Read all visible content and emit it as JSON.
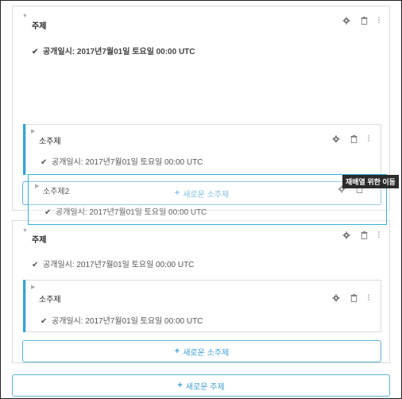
{
  "topic1": {
    "title": "주제",
    "release": "공개일시: 2017년7월01일 토요일 00:00 UTC",
    "subtopic": {
      "title": "소주제",
      "release": "공개일시: 2017년7월01일 토요일 00:00 UTC"
    },
    "add_subtopic_label": "새로운 소주제",
    "dragged_subtopic": {
      "title": "소주제2",
      "release": "공개일시: 2017년7월01일 토요일 00:00 UTC"
    },
    "tooltip": "재배열 위한 이동"
  },
  "topic2": {
    "title": "주제",
    "release": "공개일시: 2017년7월01일 토요일 00:00 UTC",
    "subtopic": {
      "title": "소주제",
      "release": "공개일시: 2017년7월01일 토요일 00:00 UTC"
    },
    "add_subtopic_label": "새로운 소주제"
  },
  "add_topic_label": "새로운 주제",
  "icons": {
    "settings": "gear-icon",
    "delete": "trash-icon",
    "drag": "drag-handle-icon",
    "check": "check-icon",
    "collapse": "caret-icon",
    "add": "plus-icon"
  },
  "colors": {
    "accent": "#2ea6de",
    "border": "#dcdcdc"
  }
}
